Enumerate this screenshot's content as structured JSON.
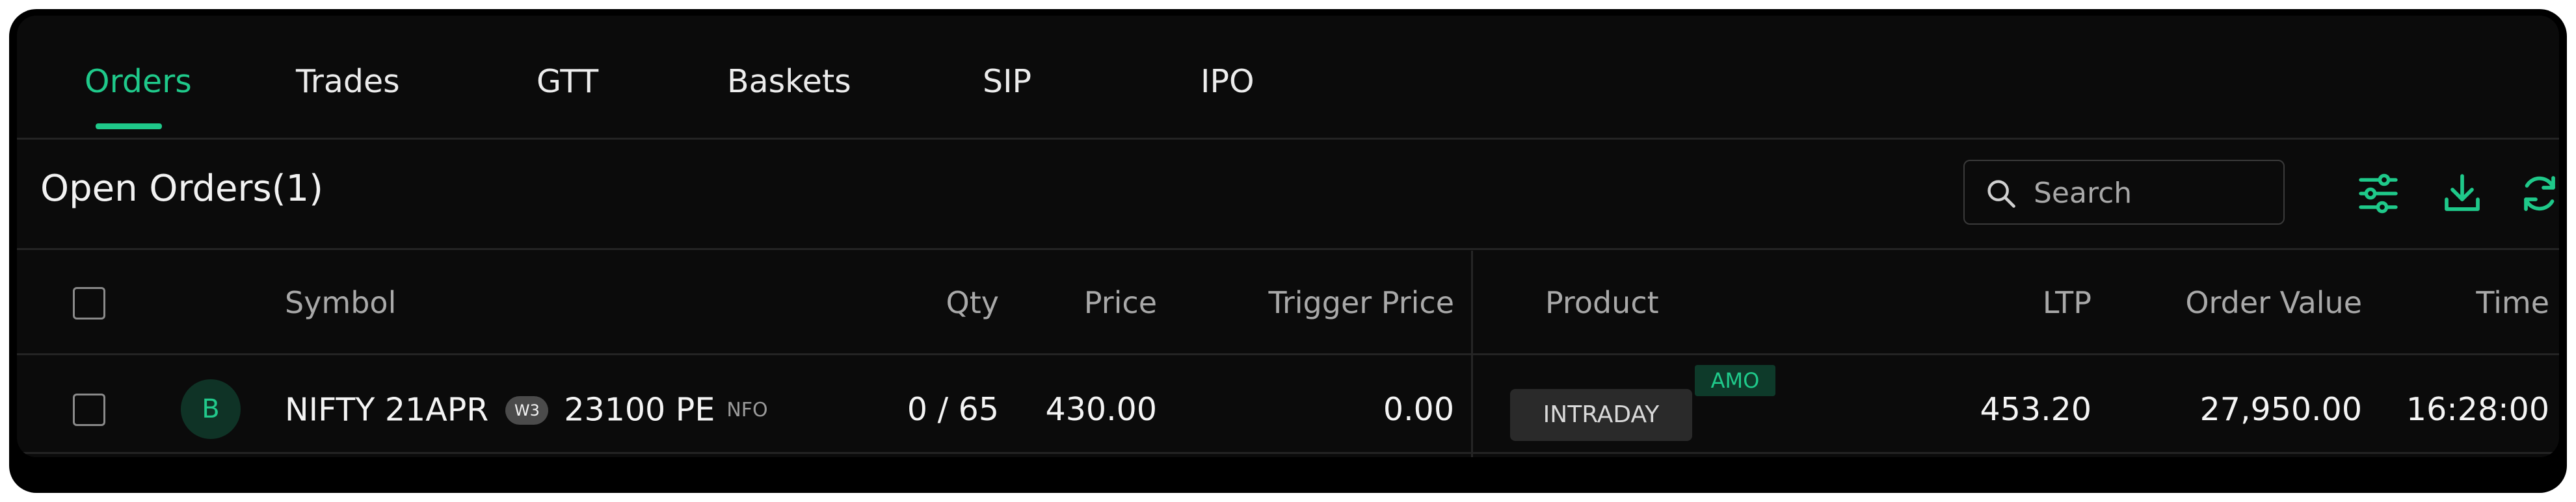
{
  "tabs": [
    {
      "label": "Orders",
      "active": true
    },
    {
      "label": "Trades"
    },
    {
      "label": "GTT"
    },
    {
      "label": "Baskets"
    },
    {
      "label": "SIP"
    },
    {
      "label": "IPO"
    }
  ],
  "section": {
    "title": "Open Orders(1)"
  },
  "search": {
    "placeholder": "Search",
    "icon": "search-icon"
  },
  "toolbar": {
    "icons": [
      "filter-sliders-icon",
      "download-icon",
      "refresh-icon"
    ]
  },
  "table": {
    "headers": {
      "symbol": "Symbol",
      "qty": "Qty",
      "price": "Price",
      "trigger_price": "Trigger Price",
      "product": "Product",
      "ltp": "LTP",
      "order_value": "Order Value",
      "time": "Time"
    },
    "rows": [
      {
        "side": "B",
        "symbol_prefix": "NIFTY 21APR",
        "week_tag": "W3",
        "symbol_suffix": "23100 PE",
        "exchange": "NFO",
        "qty": "0 / 65",
        "price": "430.00",
        "trigger_price": "0.00",
        "product": "INTRADAY",
        "amo": "AMO",
        "ltp": "453.20",
        "order_value": "27,950.00",
        "time": "16:28:00"
      }
    ]
  },
  "colors": {
    "accent": "#1fc98a",
    "background": "#0b0b0b",
    "text": "#f4f4f4",
    "muted": "#a9a9a9"
  }
}
